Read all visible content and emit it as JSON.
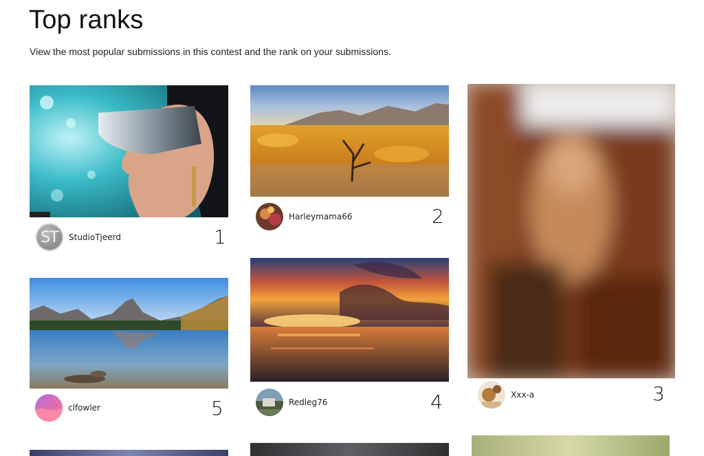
{
  "page": {
    "title": "Top ranks",
    "subtitle": "View the most popular submissions in this contest and the rank on your submissions."
  },
  "submissions": [
    {
      "rank": "1",
      "username": "StudioTjeerd",
      "avatar_initials": "ST",
      "photo": "woman-with-visor-goggles"
    },
    {
      "rank": "2",
      "username": "Harleymama66",
      "photo": "desert-sunset-tree"
    },
    {
      "rank": "3",
      "username": "Xxx-a",
      "photo": "blurred-hidden-image"
    },
    {
      "rank": "4",
      "username": "Redleg76",
      "photo": "ocean-sunset-clouds"
    },
    {
      "rank": "5",
      "username": "clfowler",
      "photo": "mountain-lake-reflection"
    }
  ]
}
